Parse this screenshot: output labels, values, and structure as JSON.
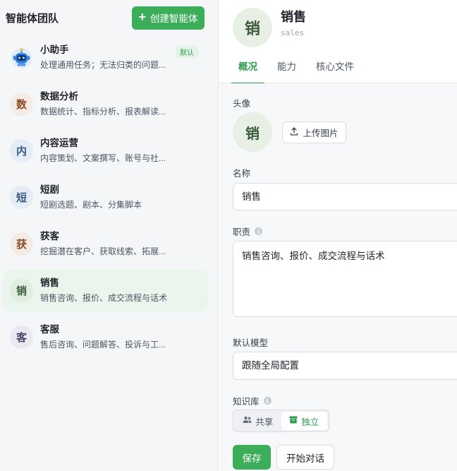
{
  "sidebar": {
    "title": "智能体团队",
    "create_button": "创建智能体",
    "agents": [
      {
        "name": "小助手",
        "desc": "处理通用任务；无法归类的问题...",
        "badge": "默认",
        "avatar_icon": "robot-icon"
      },
      {
        "name": "数据分析",
        "desc": "数据统计、指标分析、报表解读...",
        "avatar_char": "数",
        "avatar_bg": "#f4ebe4",
        "avatar_color": "#8a4b2a"
      },
      {
        "name": "内容运营",
        "desc": "内容策划、文案撰写、账号与社...",
        "avatar_char": "内",
        "avatar_bg": "#e4ecf5",
        "avatar_color": "#3b5a80"
      },
      {
        "name": "短剧",
        "desc": "短剧选题、剧本、分集脚本",
        "avatar_char": "短",
        "avatar_bg": "#e4ecf5",
        "avatar_color": "#3b5a80"
      },
      {
        "name": "获客",
        "desc": "挖掘潜在客户、获取线索、拓展...",
        "avatar_char": "获",
        "avatar_bg": "#f4ebe4",
        "avatar_color": "#8a4b2a"
      },
      {
        "name": "销售",
        "desc": "销售咨询、报价、成交流程与话术",
        "avatar_char": "销",
        "avatar_bg": "#e1eedf",
        "avatar_color": "#3b5b3b"
      },
      {
        "name": "客服",
        "desc": "售后咨询、问题解答、投诉与工...",
        "avatar_char": "客",
        "avatar_bg": "#ebe8f1",
        "avatar_color": "#4b4566"
      }
    ]
  },
  "main": {
    "avatar_char": "销",
    "title": "销售",
    "code": "sales",
    "tabs": [
      "概况",
      "能力",
      "核心文件"
    ],
    "avatar_label": "头像",
    "upload_label": "上传图片",
    "name_label": "名称",
    "name_value": "销售",
    "duty_label": "职责",
    "duty_value": "销售咨询、报价、成交流程与话术",
    "model_label": "默认模型",
    "model_value": "跟随全局配置",
    "kb_label": "知识库",
    "kb_options": [
      "共享",
      "独立"
    ],
    "save_label": "保存",
    "chat_label": "开始对话"
  },
  "colors": {
    "accent": "#3cae5a",
    "accent_text": "#2f9b4f"
  }
}
